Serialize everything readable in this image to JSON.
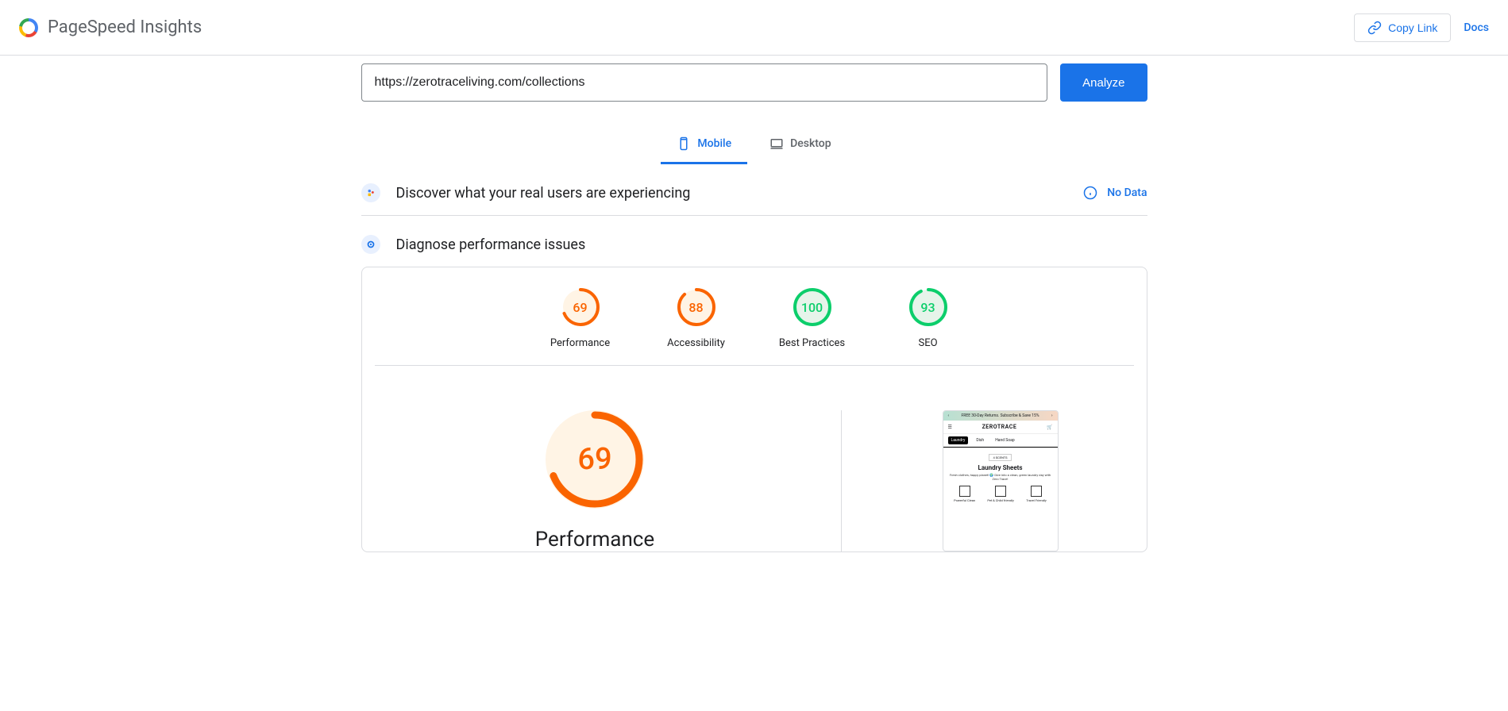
{
  "colors": {
    "orange": "#fa6400",
    "green": "#0cce6b",
    "blue": "#1a73e8"
  },
  "header": {
    "title": "PageSpeed Insights",
    "copy_link": "Copy Link",
    "docs": "Docs"
  },
  "form": {
    "url_value": "https://zerotraceliving.com/collections",
    "analyze": "Analyze"
  },
  "tabs": {
    "mobile": "Mobile",
    "desktop": "Desktop"
  },
  "discover": {
    "title": "Discover what your real users are experiencing",
    "no_data": "No Data"
  },
  "diagnose": {
    "title": "Diagnose performance issues"
  },
  "gauges": [
    {
      "label": "Performance",
      "value": 69,
      "color": "orange"
    },
    {
      "label": "Accessibility",
      "value": 88,
      "color": "orange"
    },
    {
      "label": "Best Practices",
      "value": 100,
      "color": "green"
    },
    {
      "label": "SEO",
      "value": 93,
      "color": "green"
    }
  ],
  "big_gauge": {
    "value": 69,
    "label": "Performance",
    "color": "orange"
  },
  "screenshot": {
    "banner": "FREE 30-Day Returns. Subscribe & Save 15%",
    "logo": "ZEROTRACE",
    "tabs": [
      "Laundry",
      "Dish",
      "Hand Soap"
    ],
    "badge": "4 SCENTS",
    "heading": "Laundry Sheets",
    "sub": "Fresh clothes, happy planet! 🌍 Dive into a clean, green laundry day with Zero Trace!",
    "icons": [
      {
        "label": "Powerful Clean"
      },
      {
        "label": "Pet & Child friendly"
      },
      {
        "label": "Travel Friendly"
      }
    ]
  }
}
